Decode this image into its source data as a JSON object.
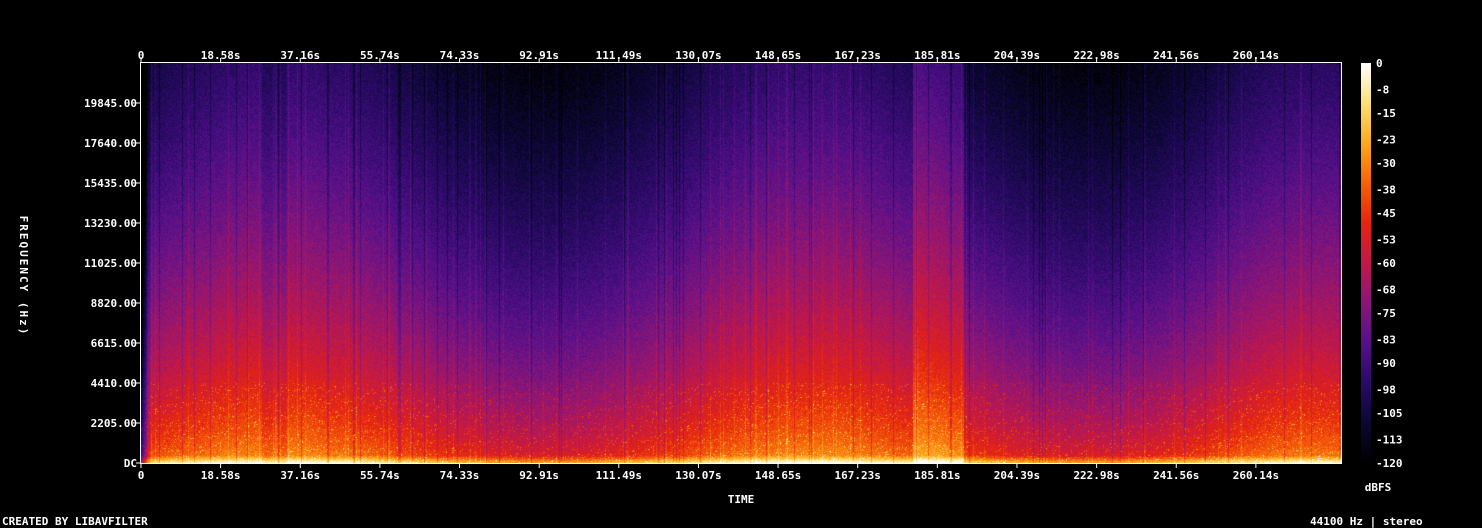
{
  "chart_data": {
    "type": "heatmap",
    "title": "",
    "xlabel": "TIME",
    "ylabel": "FREQUENCY (Hz)",
    "x_ticks": [
      "0",
      "18.58s",
      "37.16s",
      "55.74s",
      "74.33s",
      "92.91s",
      "111.49s",
      "130.07s",
      "148.65s",
      "167.23s",
      "185.81s",
      "204.39s",
      "222.98s",
      "241.56s",
      "260.14s"
    ],
    "x_tick_values": [
      0,
      18.58,
      37.16,
      55.74,
      74.33,
      92.91,
      111.49,
      130.07,
      148.65,
      167.23,
      185.81,
      204.39,
      222.98,
      241.56,
      260.14
    ],
    "xlim": [
      0,
      280
    ],
    "y_ticks": [
      "DC",
      "2205.00",
      "4410.00",
      "6615.00",
      "8820.00",
      "11025.00",
      "13230.00",
      "15435.00",
      "17640.00",
      "19845.00"
    ],
    "y_tick_values": [
      0,
      2205,
      4410,
      6615,
      8820,
      11025,
      13230,
      15435,
      17640,
      19845
    ],
    "ylim": [
      0,
      22050
    ],
    "colorbar": {
      "label": "dBFS",
      "ticks": [
        "0",
        "-8",
        "-15",
        "-23",
        "-30",
        "-38",
        "-45",
        "-53",
        "-60",
        "-68",
        "-75",
        "-83",
        "-90",
        "-98",
        "-105",
        "-113",
        "-120"
      ],
      "range": [
        -120,
        0
      ]
    },
    "colormap": [
      "#000000",
      "#0b0733",
      "#2a0a66",
      "#55108a",
      "#8a1678",
      "#c0184a",
      "#e6240f",
      "#f5620a",
      "#fbaa1c",
      "#fde07a",
      "#ffffff"
    ]
  },
  "footer": {
    "left": "CREATED BY LIBAVFILTER",
    "right": "44100 Hz | stereo"
  }
}
